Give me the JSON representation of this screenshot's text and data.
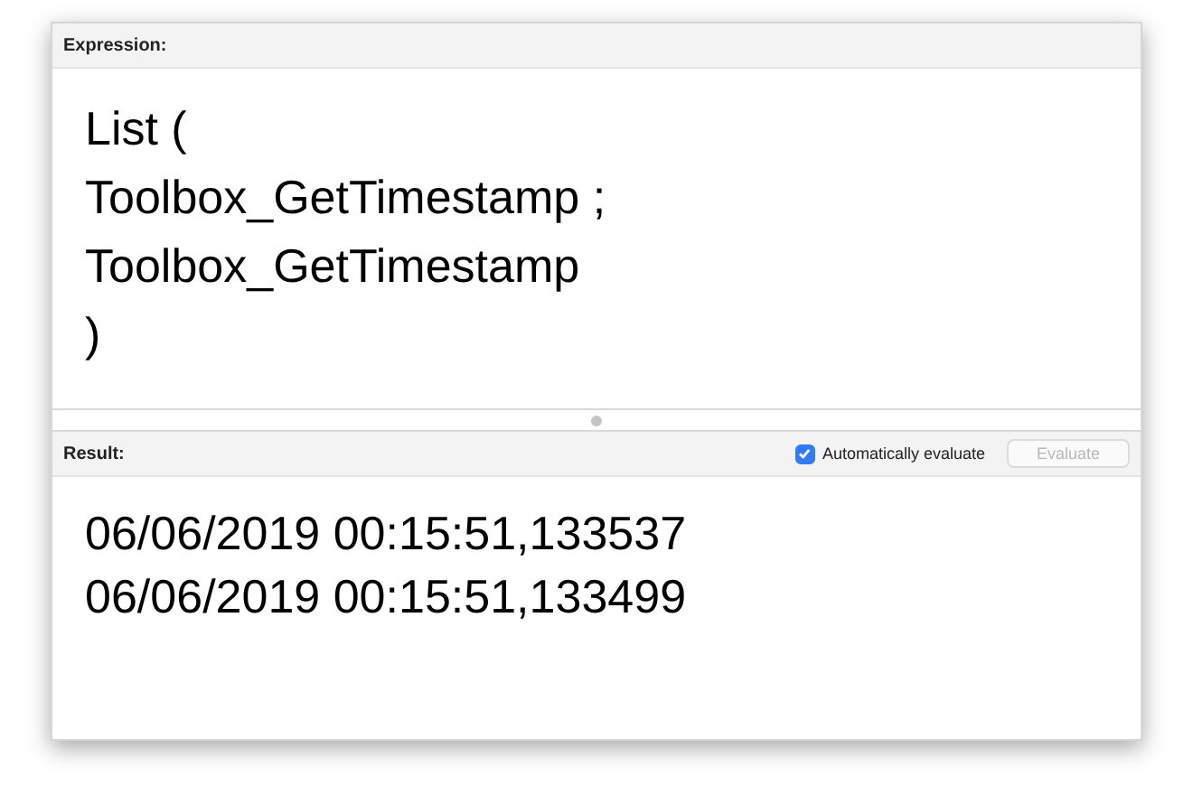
{
  "expression": {
    "label": "Expression:",
    "lines": [
      "List (",
      "Toolbox_GetTimestamp ;",
      "Toolbox_GetTimestamp",
      ")"
    ]
  },
  "result": {
    "label": "Result:",
    "auto_evaluate": {
      "label": "Automatically evaluate",
      "checked": true
    },
    "evaluate_button": {
      "label": "Evaluate",
      "disabled": true
    },
    "lines": [
      "06/06/2019 00:15:51,133537",
      "06/06/2019 00:15:51,133499"
    ]
  }
}
